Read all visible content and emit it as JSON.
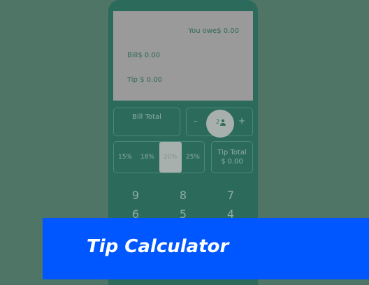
{
  "display": {
    "you_owe": "You owe$ 0.00",
    "bill": "Bill$ 0.00",
    "tip": "Tip $ 0.00"
  },
  "bill_total": {
    "label": "Bill Total"
  },
  "people": {
    "minus": "–",
    "plus": "+",
    "count": "2"
  },
  "tip_options": [
    "15%",
    "18%",
    "20%",
    "25%"
  ],
  "tip_selected": "20%",
  "tip_total": {
    "label": "Tip Total",
    "value": "$ 0.00"
  },
  "keypad": {
    "row1": [
      "9",
      "8",
      "7"
    ],
    "row2": [
      "6",
      "5",
      "4"
    ]
  },
  "banner": {
    "title": "Tip Calculator"
  },
  "colors": {
    "background": "#4e7566",
    "phone": "#2c6b5c",
    "display": "#9a9a9a",
    "accent_banner": "#0057ff"
  }
}
